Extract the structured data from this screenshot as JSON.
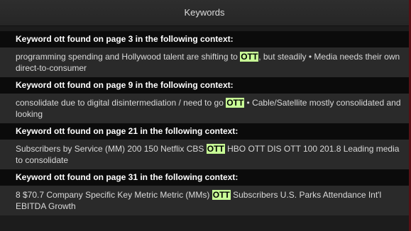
{
  "window": {
    "title": "Keywords"
  },
  "results": [
    {
      "header": "Keyword ott found on page 3 in the following context:",
      "before": "programming spending and Hollywood talent are shifting to ",
      "match": "OTT",
      "after": ", but steadily • Media needs their own direct-to-consumer"
    },
    {
      "header": "Keyword ott found on page 9 in the following context:",
      "before": "consolidate due to digital disintermediation / need to go ",
      "match": "OTT",
      "after": " • Cable/Satellite mostly consolidated and looking"
    },
    {
      "header": "Keyword ott found on page 21 in the following context:",
      "before": "Subscribers by Service (MM) 200 150 Netflix CBS ",
      "match": "OTT",
      "after": " HBO OTT DIS OTT 100 201.8 Leading media to consolidate"
    },
    {
      "header": "Keyword ott found on page 31 in the following context:",
      "before": "8 $70.7 Company Specific Key Metric Metric (MMs) ",
      "match": "OTT",
      "after": " Subscribers U.S. Parks Attendance Int'l EBITDA Growth"
    }
  ],
  "colors": {
    "highlight": "#c8ff96",
    "header_bg": "#0b0b0b",
    "body_bg": "#2a2a2a",
    "accent_border": "#5a0f14"
  }
}
